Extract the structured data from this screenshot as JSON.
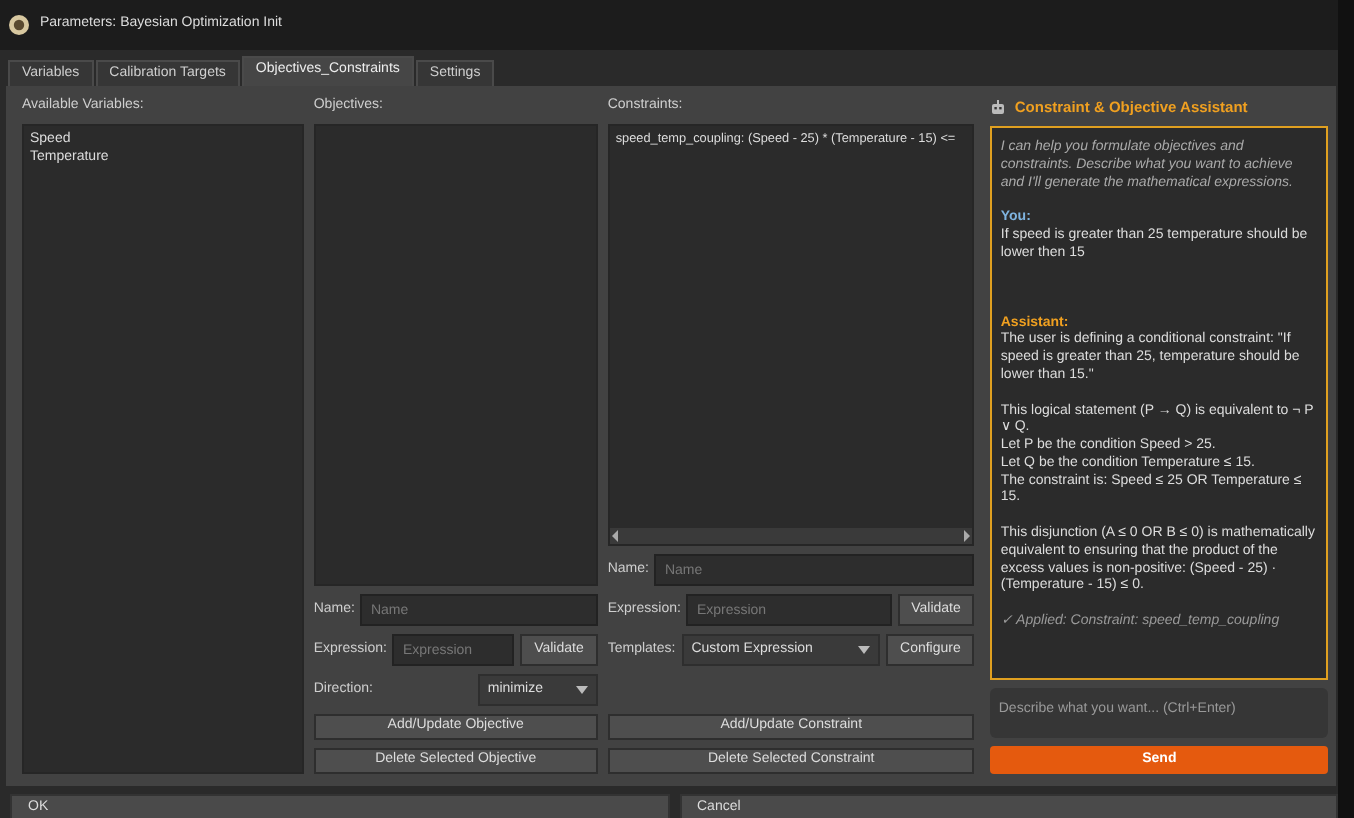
{
  "window": {
    "title": "Parameters: Bayesian Optimization Init"
  },
  "tabs": [
    {
      "label": "Variables",
      "selected": false
    },
    {
      "label": "Calibration Targets",
      "selected": false
    },
    {
      "label": "Objectives_Constraints",
      "selected": true
    },
    {
      "label": "Settings",
      "selected": false
    }
  ],
  "variables": {
    "label": "Available Variables:",
    "items": [
      "Speed",
      "Temperature"
    ]
  },
  "objectives": {
    "label": "Objectives:",
    "name_label": "Name:",
    "name_placeholder": "Name",
    "expression_label": "Expression:",
    "expression_placeholder": "Expression",
    "validate_button": "Validate",
    "direction_label": "Direction:",
    "direction_value": "minimize",
    "add_button": "Add/Update Objective",
    "delete_button": "Delete Selected Objective"
  },
  "constraints": {
    "label": "Constraints:",
    "items": [
      "speed_temp_coupling: (Speed - 25) * (Temperature - 15) <="
    ],
    "name_label": "Name:",
    "name_placeholder": "Name",
    "expression_label": "Expression:",
    "expression_placeholder": "Expression",
    "validate_button": "Validate",
    "templates_label": "Templates:",
    "templates_value": "Custom Expression",
    "configure_button": "Configure",
    "add_button": "Add/Update Constraint",
    "delete_button": "Delete Selected Constraint"
  },
  "assistant": {
    "title": "Constraint & Objective Assistant",
    "messages": [
      {
        "kind": "intro",
        "paragraphs": [
          [
            "I can help you formulate objectives and constraints. Describe what you want to achieve and I'll generate the mathematical expressions."
          ]
        ]
      },
      {
        "kind": "user",
        "speaker": "You:",
        "paragraphs": [
          [
            "If speed is greater than 25 temperature should be lower then 15"
          ]
        ]
      },
      {
        "kind": "assistant",
        "speaker": "Assistant:",
        "paragraphs": [
          [
            "The user is defining a conditional constraint: \"If speed is greater than 25, temperature should be lower than 15.\""
          ],
          [
            "This logical statement (P → Q) is equivalent to ¬ P ∨ Q.",
            "Let P be the condition Speed > 25.",
            "Let Q be the condition Temperature ≤ 15.",
            "The constraint is: Speed ≤ 25 OR Temperature ≤ 15."
          ],
          [
            "This disjunction (A ≤ 0 OR B ≤ 0) is mathematically equivalent to ensuring that the product of the excess values is non-positive: (Speed - 25) · (Temperature - 15) ≤ 0."
          ]
        ]
      },
      {
        "kind": "applied",
        "paragraphs": [
          [
            "✓ Applied: Constraint: speed_temp_coupling"
          ]
        ]
      }
    ],
    "input_placeholder": "Describe what you want... (Ctrl+Enter)",
    "send_button": "Send"
  },
  "buttons": [
    {
      "label": "OK"
    },
    {
      "label": "Cancel"
    }
  ]
}
